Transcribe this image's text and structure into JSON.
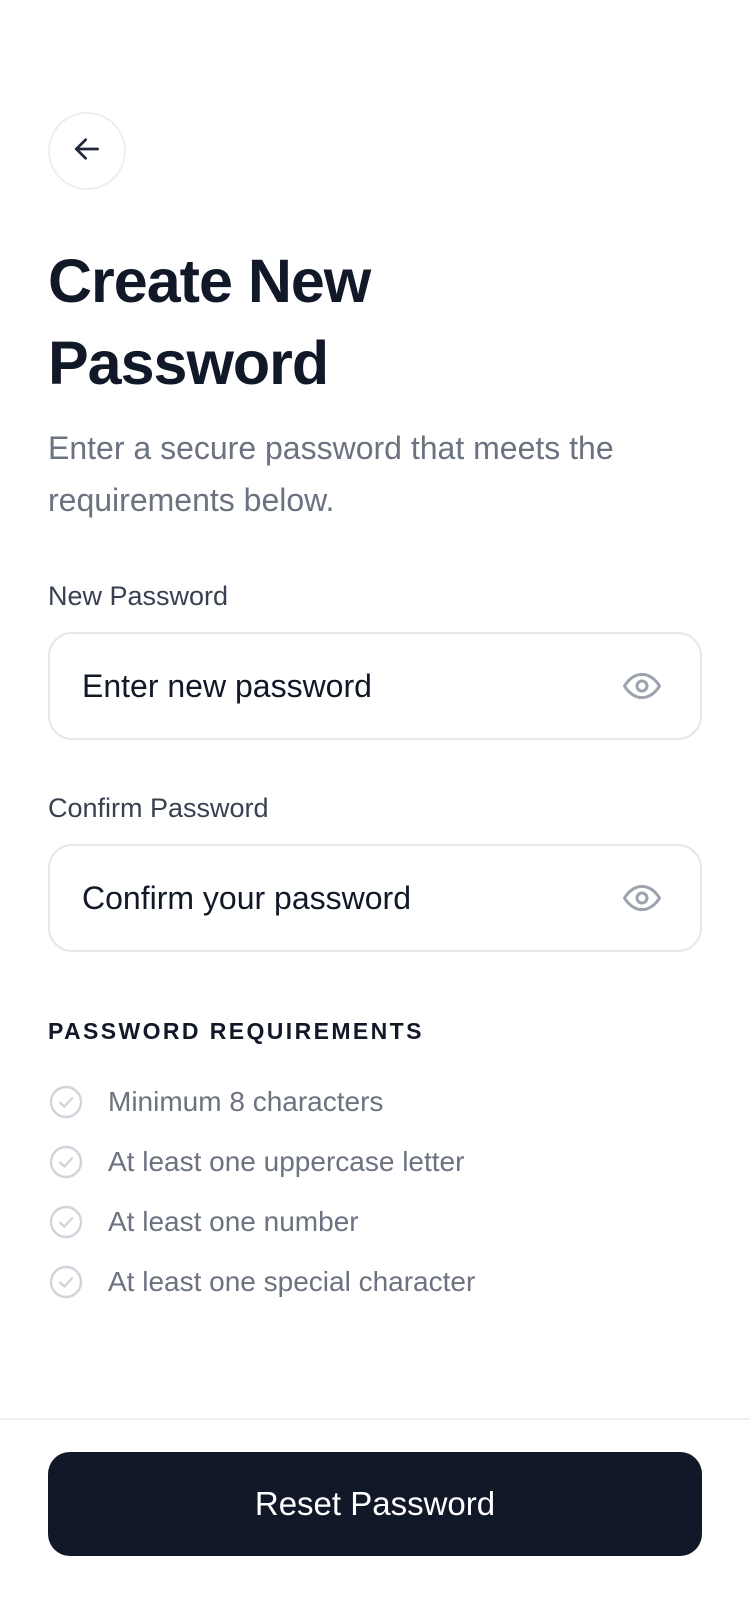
{
  "header": {
    "back_icon": "arrow-left-icon"
  },
  "page": {
    "title": "Create New Password",
    "subtitle": "Enter a secure password that meets the requirements below."
  },
  "form": {
    "new_password": {
      "label": "New Password",
      "placeholder": "Enter new password",
      "value": "",
      "toggle_icon": "eye-icon"
    },
    "confirm_password": {
      "label": "Confirm Password",
      "placeholder": "Confirm your password",
      "value": "",
      "toggle_icon": "eye-icon"
    }
  },
  "requirements": {
    "heading": "PASSWORD REQUIREMENTS",
    "check_icon": "check-circle-icon",
    "items": [
      {
        "label": "Minimum 8 characters",
        "met": false
      },
      {
        "label": "At least one uppercase letter",
        "met": false
      },
      {
        "label": "At least one number",
        "met": false
      },
      {
        "label": "At least one special character",
        "met": false
      }
    ]
  },
  "footer": {
    "submit_label": "Reset Password"
  },
  "colors": {
    "primary": "#111827",
    "muted_text": "#6b7280",
    "border": "#e5e7eb",
    "icon_gray": "#9ca3af",
    "check_gray": "#d1d5db"
  }
}
